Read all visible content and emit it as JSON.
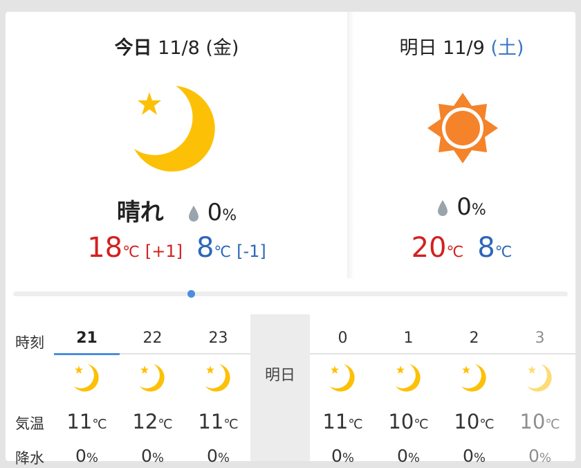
{
  "today": {
    "date_bold": "今日",
    "date_rest": "11/8 (金)",
    "icon": "moon-star-icon",
    "condition": "晴れ",
    "precip_value": "0",
    "precip_unit": "%",
    "high": "18",
    "high_diff": "[+1]",
    "low": "8",
    "low_diff": "[-1]",
    "temp_unit": "℃"
  },
  "tomorrow": {
    "date_main": "明日 11/9",
    "date_day": "(土)",
    "icon": "sun-icon",
    "precip_value": "0",
    "precip_unit": "%",
    "high": "20",
    "low": "8",
    "temp_unit": "℃"
  },
  "hourly": {
    "label_time": "時刻",
    "label_temp": "気温",
    "label_precip": "降水",
    "tomorrow_label": "明日",
    "temp_unit": "℃",
    "precip_unit": "%",
    "hours": [
      {
        "hour": "21",
        "temp": "11",
        "precip": "0",
        "icon": "moon-star-icon"
      },
      {
        "hour": "22",
        "temp": "12",
        "precip": "0",
        "icon": "moon-star-icon"
      },
      {
        "hour": "23",
        "temp": "11",
        "precip": "0",
        "icon": "moon-star-icon"
      },
      {
        "hour": "0",
        "temp": "11",
        "precip": "0",
        "icon": "moon-star-icon"
      },
      {
        "hour": "1",
        "temp": "10",
        "precip": "0",
        "icon": "moon-star-icon"
      },
      {
        "hour": "2",
        "temp": "10",
        "precip": "0",
        "icon": "moon-star-icon"
      },
      {
        "hour": "3",
        "temp": "10",
        "precip": "0",
        "icon": "moon-star-icon"
      }
    ]
  },
  "colors": {
    "high": "#d32020",
    "low": "#2e67b8",
    "moon": "#fcc107",
    "sun": "#f5832a",
    "accent": "#4a8ee0",
    "saturday": "#3a76c4"
  }
}
